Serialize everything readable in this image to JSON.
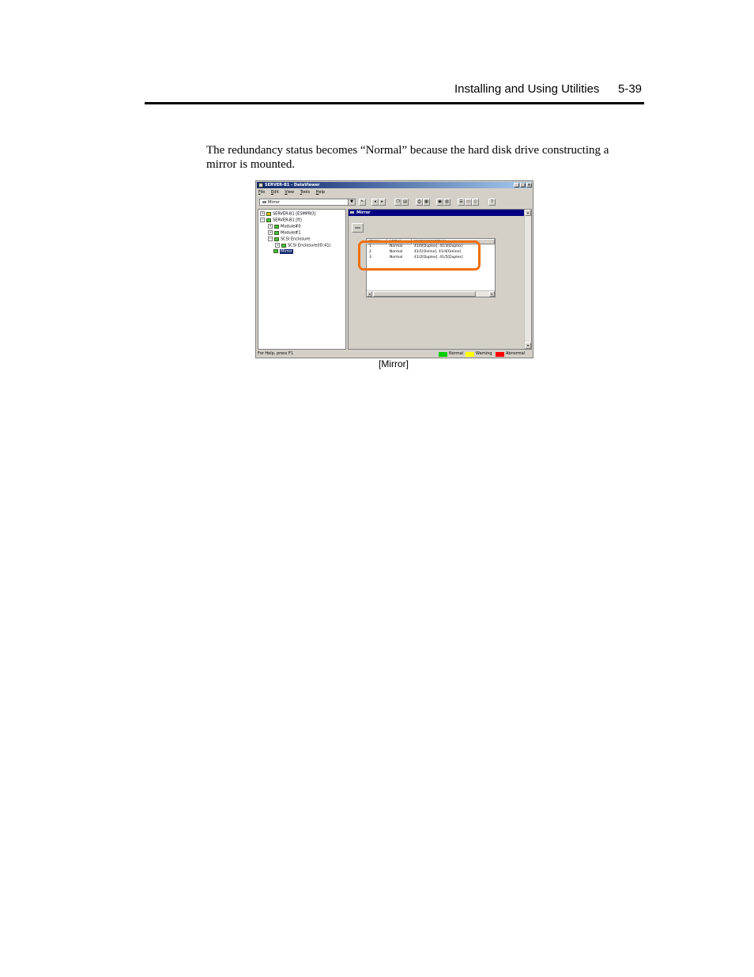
{
  "header": {
    "title": "Installing and Using Utilities",
    "page": "5-39"
  },
  "body": {
    "paragraph": "The redundancy status becomes “Normal” because the hard disk drive constructing a mirror is mounted."
  },
  "window": {
    "title": "SERVER-B1 - DataViewer",
    "controls": {
      "minimize": "_",
      "maximize": "□",
      "close": "×"
    },
    "menu": [
      {
        "accel": "F",
        "rest": "ile"
      },
      {
        "accel": "E",
        "rest": "dit"
      },
      {
        "accel": "V",
        "rest": "iew"
      },
      {
        "accel": "T",
        "rest": "ools"
      },
      {
        "accel": "H",
        "rest": "elp"
      }
    ],
    "combo_value": "Mirror",
    "tree": [
      {
        "label": "SERVER-B1 [ESMPRO]",
        "expander": "+",
        "color": "#e0c000"
      },
      {
        "label": "SERVER-B1 [ft]",
        "expander": "−",
        "color": "#40c040"
      },
      {
        "label": "Module#0",
        "expander": "+",
        "color": "#40c040"
      },
      {
        "label": "Module#1",
        "expander": "+",
        "color": "#40c040"
      },
      {
        "label": "SCSI Enclosure",
        "expander": "−",
        "color": "#40c040"
      },
      {
        "label": "SCSI Enclosure(ID:41)",
        "expander": "+",
        "color": "#40c040"
      },
      {
        "label": "Mirror",
        "expander": "",
        "color": "#40c040"
      }
    ],
    "panel_title": "Mirror",
    "columns": [
      "Mirror",
      "Status",
      "Hard Disk[Status]"
    ],
    "rows": [
      [
        "1",
        "Normal",
        "41/0[Duplex], 41/3[Duplex]"
      ],
      [
        "2",
        "Normal",
        "41/1[Online], 41/4[Online]"
      ],
      [
        "3",
        "Normal",
        "41/2[Duplex], 41/5[Duplex]"
      ]
    ],
    "status_help": "For Help, press F1",
    "legend": [
      {
        "label": "Normal",
        "color": "#00cc00"
      },
      {
        "label": "Warning",
        "color": "#ffff00"
      },
      {
        "label": "Abnormal",
        "color": "#ff0000"
      }
    ]
  },
  "caption": "[Mirror]"
}
